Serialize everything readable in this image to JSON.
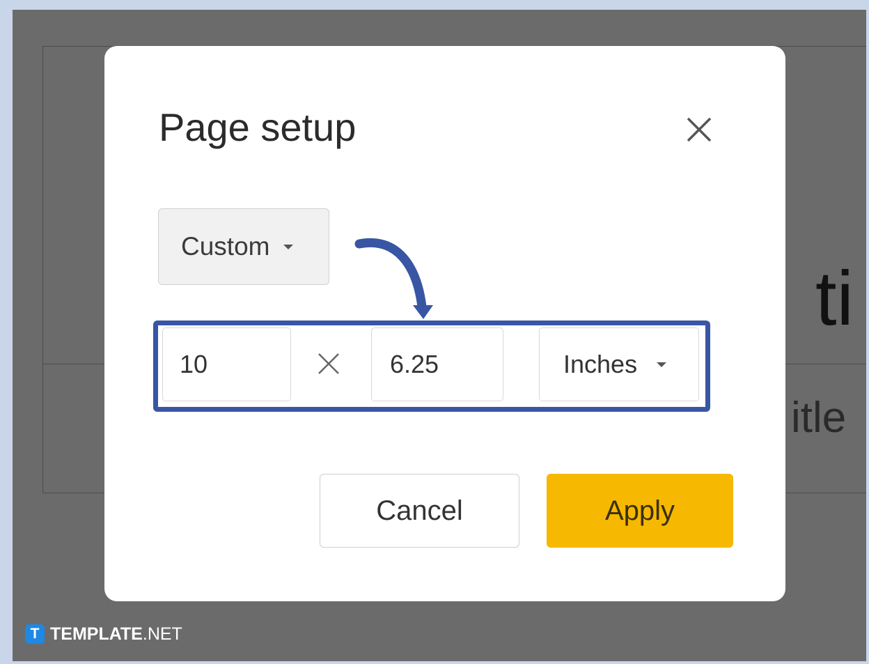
{
  "background": {
    "title_fragment": "ti",
    "subtitle_fragment": "itle"
  },
  "dialog": {
    "title": "Page setup",
    "close_icon": "close-icon",
    "preset": {
      "value": "Custom",
      "icon": "chevron-down-icon"
    },
    "width_value": "10",
    "separator_icon": "times-icon",
    "height_value": "6.25",
    "units": {
      "value": "Inches",
      "icon": "chevron-down-icon"
    },
    "cancel_label": "Cancel",
    "apply_label": "Apply"
  },
  "annotation": {
    "highlight_color": "#3856a4",
    "arrow_color": "#3856a4"
  },
  "colors": {
    "apply_button": "#f6b800",
    "overlay": "#6b6b6b"
  },
  "watermark": {
    "logo_letter": "T",
    "name_bold": "TEMPLATE",
    "name_suffix": ".NET"
  }
}
